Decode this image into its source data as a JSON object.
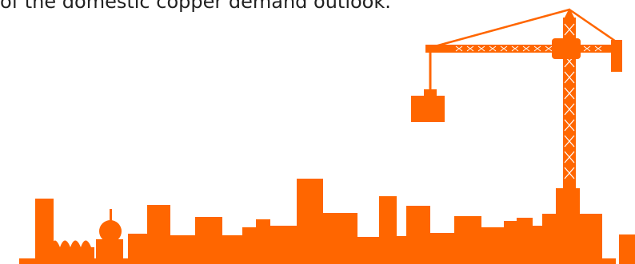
{
  "caption": {
    "text": "of the domestic copper demand outlook."
  },
  "illustration": {
    "subject": "city-skyline-with-tower-crane",
    "color": "#FF6600"
  }
}
